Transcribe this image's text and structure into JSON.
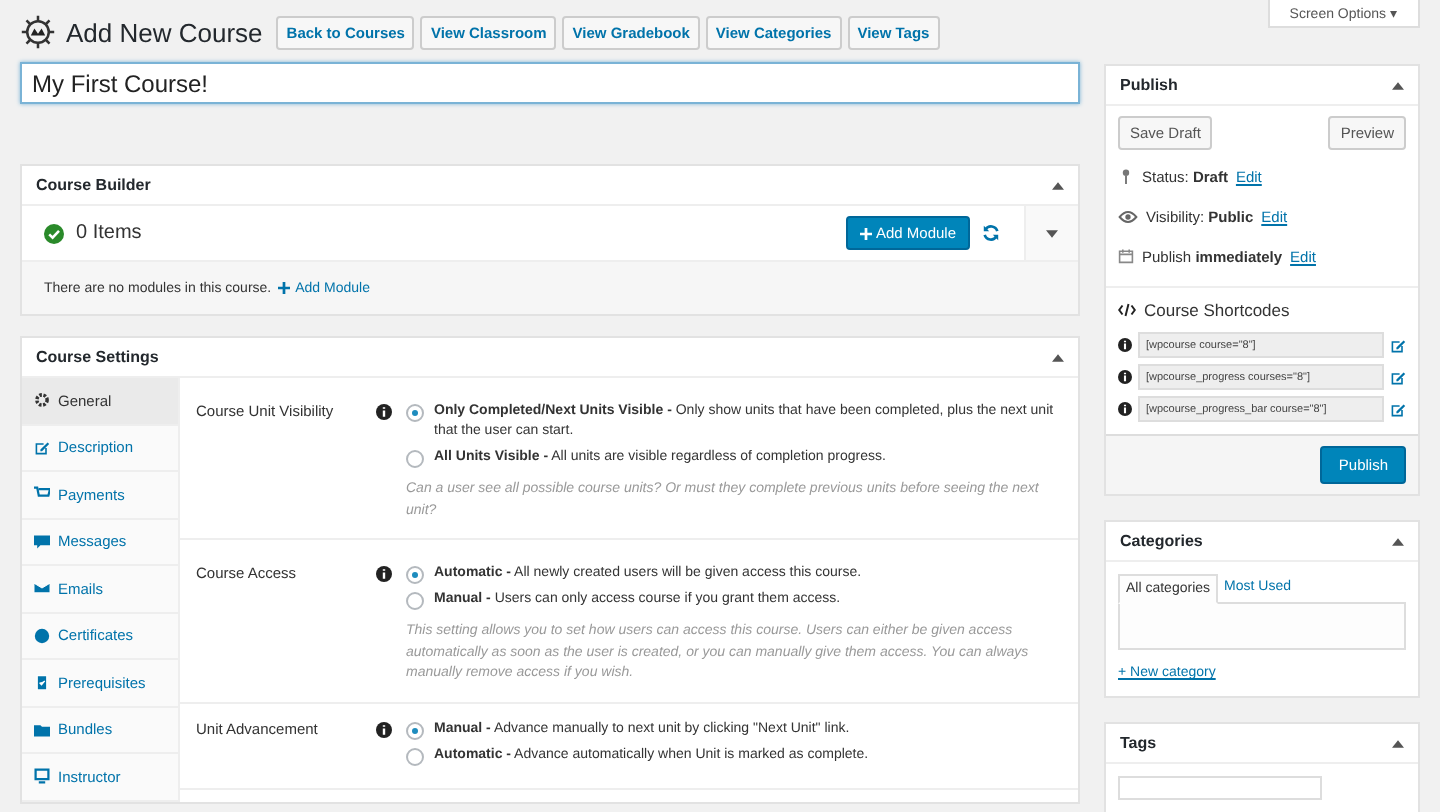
{
  "header": {
    "title": "Add New Course",
    "buttons": [
      "Back to Courses",
      "View Classroom",
      "View Gradebook",
      "View Categories",
      "View Tags"
    ],
    "screen_options": "Screen Options ▾"
  },
  "course_title": {
    "value": "My First Course!"
  },
  "course_builder": {
    "title": "Course Builder",
    "count": "0 Items",
    "add_button": "Add Module",
    "empty_text": "There are no modules in this course.",
    "add_link": "Add Module"
  },
  "course_settings": {
    "title": "Course Settings",
    "tabs": [
      {
        "label": "General",
        "selected": true
      },
      {
        "label": "Description",
        "selected": false
      },
      {
        "label": "Payments",
        "selected": false
      },
      {
        "label": "Messages",
        "selected": false
      },
      {
        "label": "Emails",
        "selected": false
      },
      {
        "label": "Certificates",
        "selected": false
      },
      {
        "label": "Prerequisites",
        "selected": false
      },
      {
        "label": "Bundles",
        "selected": false
      },
      {
        "label": "Instructor",
        "selected": false
      }
    ],
    "rows": [
      {
        "label": "Course Unit Visibility",
        "options": [
          {
            "text": "**Only Completed/Next Units Visible -** Only show units that have been completed, plus the next unit that the user can start.",
            "selected": true
          },
          {
            "text": "**All Units Visible -** All units are visible regardless of completion progress.",
            "selected": false
          }
        ],
        "help": "Can a user see all possible course units? Or must they complete previous units before seeing the next unit?"
      },
      {
        "label": "Course Access",
        "options": [
          {
            "text": "**Automatic -** All newly created users will be given access this course.",
            "selected": true
          },
          {
            "text": "**Manual -** Users can only access course if you grant them access.",
            "selected": false
          }
        ],
        "help": "This setting allows you to set how users can access this course. Users can either be given access automatically as soon as the user is created, or you can manually give them access. You can always manually remove access if you wish."
      },
      {
        "label": "Unit Advancement",
        "options": [
          {
            "text": "**Manual -** Advance manually to next unit by clicking \"Next Unit\" link.",
            "selected": true
          },
          {
            "text": "**Automatic -** Advance automatically when Unit is marked as complete.",
            "selected": false
          }
        ]
      }
    ]
  },
  "publish": {
    "title": "Publish",
    "save_draft": "Save Draft",
    "preview": "Preview",
    "meta": [
      {
        "label": "Status:",
        "value": "Draft",
        "link": "Edit"
      },
      {
        "label": "Visibility:",
        "value": "Public",
        "link": "Edit"
      },
      {
        "label": "Publish",
        "value": "immediately",
        "link": "Edit"
      }
    ],
    "shortcodes_title": "Course Shortcodes",
    "shortcodes": [
      "[wpcourse course=\"8\"]",
      "[wpcourse_progress courses=\"8\"]",
      "[wpcourse_progress_bar course=\"8\"]"
    ],
    "publish_button": "Publish"
  },
  "categories": {
    "title": "Categories",
    "tabs": [
      {
        "label": "All categories",
        "selected": true
      },
      {
        "label": "Most Used",
        "selected": false
      }
    ],
    "new_link": "+ New category"
  },
  "tags": {
    "title": "Tags"
  }
}
